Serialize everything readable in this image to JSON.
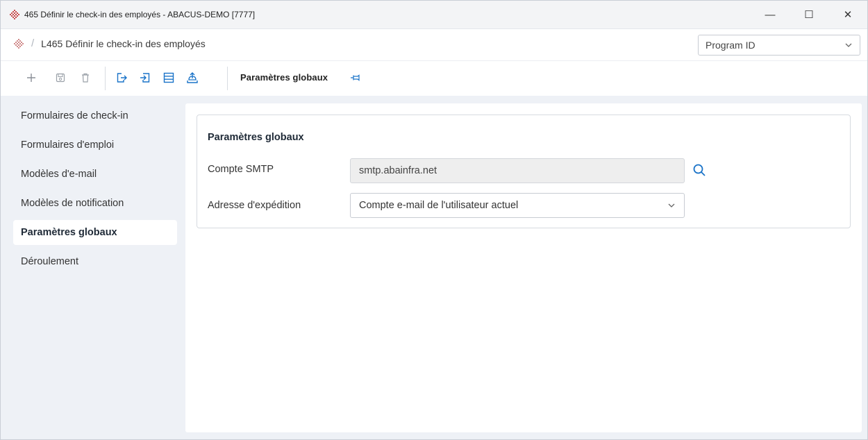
{
  "window": {
    "title": "465 Définir le check-in des employés - ABACUS-DEMO [7777]",
    "controls": {
      "minimize": "—",
      "maximize": "☐",
      "close": "✕"
    }
  },
  "breadcrumb": {
    "separator": "/",
    "current": "L465 Définir le check-in des employés"
  },
  "program_select": {
    "value": "Program ID"
  },
  "toolbar": {
    "icons": [
      "add-icon",
      "save-icon",
      "delete-icon",
      "export-icon",
      "import-icon",
      "list-icon",
      "upload-icon"
    ],
    "label": "Paramètres globaux",
    "pin_icon": "pin-icon"
  },
  "sidebar": {
    "items": [
      {
        "label": "Formulaires de check-in",
        "active": false
      },
      {
        "label": "Formulaires d'emploi",
        "active": false
      },
      {
        "label": "Modèles d'e-mail",
        "active": false
      },
      {
        "label": "Modèles de notification",
        "active": false
      },
      {
        "label": "Paramètres globaux",
        "active": true
      },
      {
        "label": "Déroulement",
        "active": false
      }
    ]
  },
  "main": {
    "card_title": "Paramètres globaux",
    "smtp": {
      "label": "Compte SMTP",
      "value": "smtp.abainfra.net"
    },
    "sender": {
      "label": "Adresse d'expédition",
      "value": "Compte e-mail de l'utilisateur actuel"
    }
  },
  "colors": {
    "accent": "#1a73c8",
    "brand": "#c0392b",
    "sidebar_bg": "#eef1f6"
  }
}
